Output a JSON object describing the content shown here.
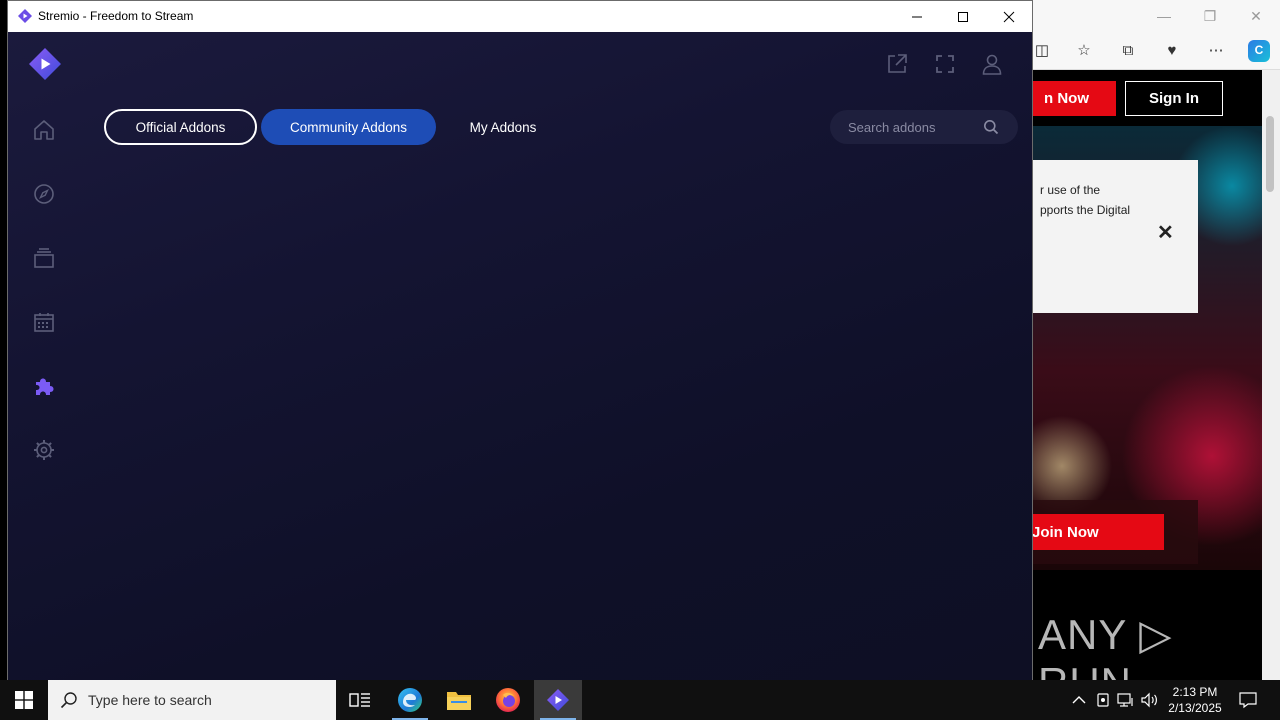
{
  "window": {
    "title": "Stremio - Freedom to Stream"
  },
  "addons_tabs": [
    {
      "label": "Official Addons",
      "state": "outlined"
    },
    {
      "label": "Community Addons",
      "state": "selected"
    },
    {
      "label": "My Addons",
      "state": "plain"
    }
  ],
  "search": {
    "placeholder": "Search addons"
  },
  "sidebar": {
    "items": [
      "home-icon",
      "discover-icon",
      "library-icon",
      "calendar-icon",
      "addons-icon",
      "settings-icon"
    ],
    "active": "addons-icon"
  },
  "background_browser": {
    "join_now_partial": "n Now",
    "sign_in": "Sign In",
    "cookie_line1": "r use of the",
    "cookie_line2": "pports the Digital",
    "join_now": "Join Now",
    "watermark": "ANY ▷ RUN"
  },
  "taskbar": {
    "search_placeholder": "Type here to search",
    "time": "2:13 PM",
    "date": "2/13/2025"
  },
  "colors": {
    "accent": "#7b5bf5",
    "selected_tab": "#1e4db6",
    "app_bg": "#141432",
    "brand_red": "#e50914"
  }
}
